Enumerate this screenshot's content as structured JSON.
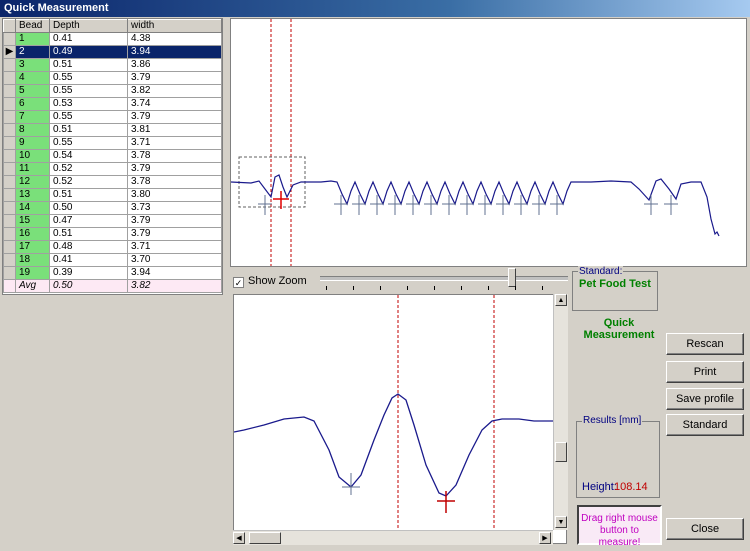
{
  "window": {
    "title": "Quick Measurement"
  },
  "table": {
    "columns": [
      "Bead",
      "Depth",
      "width"
    ],
    "rows": [
      {
        "bead": "1",
        "depth": "0.41",
        "width": "4.38"
      },
      {
        "bead": "2",
        "depth": "0.49",
        "width": "3.94"
      },
      {
        "bead": "3",
        "depth": "0.51",
        "width": "3.86"
      },
      {
        "bead": "4",
        "depth": "0.55",
        "width": "3.79"
      },
      {
        "bead": "5",
        "depth": "0.55",
        "width": "3.82"
      },
      {
        "bead": "6",
        "depth": "0.53",
        "width": "3.74"
      },
      {
        "bead": "7",
        "depth": "0.55",
        "width": "3.79"
      },
      {
        "bead": "8",
        "depth": "0.51",
        "width": "3.81"
      },
      {
        "bead": "9",
        "depth": "0.55",
        "width": "3.71"
      },
      {
        "bead": "10",
        "depth": "0.54",
        "width": "3.78"
      },
      {
        "bead": "11",
        "depth": "0.52",
        "width": "3.79"
      },
      {
        "bead": "12",
        "depth": "0.52",
        "width": "3.78"
      },
      {
        "bead": "13",
        "depth": "0.51",
        "width": "3.80"
      },
      {
        "bead": "14",
        "depth": "0.50",
        "width": "3.73"
      },
      {
        "bead": "15",
        "depth": "0.47",
        "width": "3.79"
      },
      {
        "bead": "16",
        "depth": "0.51",
        "width": "3.79"
      },
      {
        "bead": "17",
        "depth": "0.48",
        "width": "3.71"
      },
      {
        "bead": "18",
        "depth": "0.41",
        "width": "3.70"
      },
      {
        "bead": "19",
        "depth": "0.39",
        "width": "3.94"
      }
    ],
    "selected_bead": "2",
    "avg": {
      "label": "Avg",
      "depth": "0.50",
      "width": "3.82"
    }
  },
  "zoom": {
    "show_zoom_label": "Show Zoom",
    "checked": true
  },
  "standard": {
    "label": "Standard:",
    "value": "Pet Food Test"
  },
  "mode": {
    "line1": "Quick",
    "line2": "Measurement"
  },
  "results": {
    "label": "Results [mm]",
    "height_label": "Height:",
    "height_value": "108.14"
  },
  "hint": {
    "text": "Drag right mouse button to measure!"
  },
  "buttons": {
    "rescan": "Rescan",
    "print": "Print",
    "save_profile": "Save profile",
    "standard": "Standard",
    "close": "Close"
  },
  "colors": {
    "profile_line": "#1a1a8c",
    "cursor": "#e00000",
    "selection": "#0a246a",
    "bead_cell": "#7ae07a",
    "mode_text": "#008000"
  }
}
